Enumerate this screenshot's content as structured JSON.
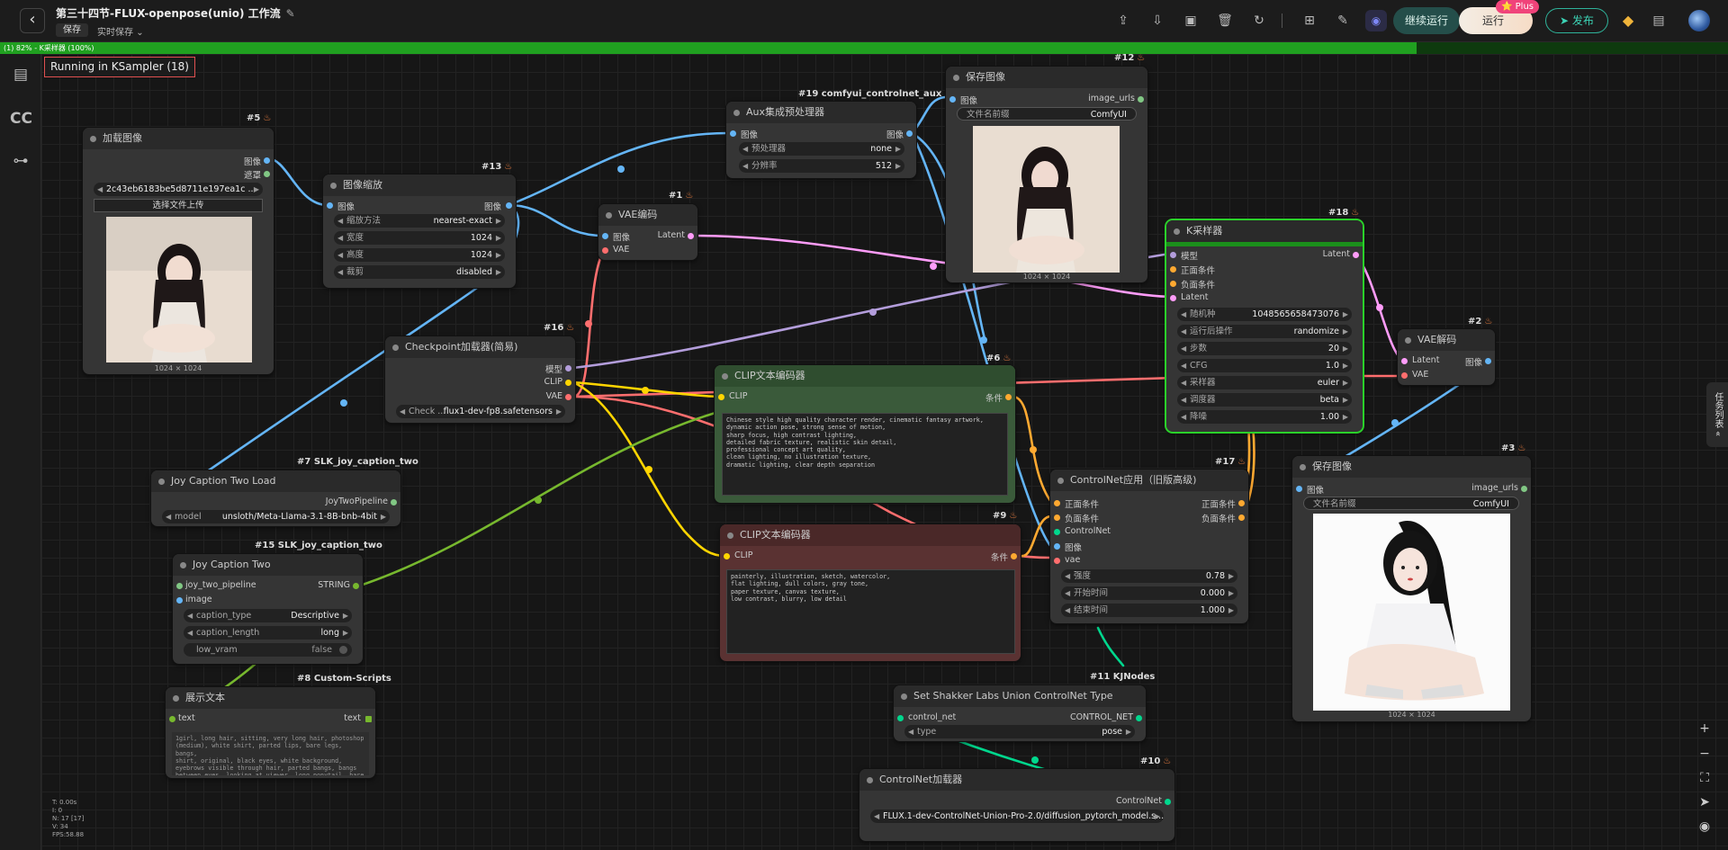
{
  "topbar": {
    "back_icon": "chevron-left-icon",
    "title": "第三十四节-FLUX-openpose(unio) 工作流",
    "edit_icon": "✎",
    "save_label": "保存",
    "autosave_label": "实时保存",
    "continue_label": "继续运行",
    "run_label": "运行",
    "plus_badge": "⭐ Plus",
    "publish_label": "发布",
    "accent_color": "#2fb39a"
  },
  "progress": {
    "label": "(1) 82% - K采样器 (100%)",
    "percent": 82
  },
  "status": {
    "running": "Running in KSampler (18)"
  },
  "stats": [
    "T: 0.00s",
    "I: 0",
    "N: 17 [17]",
    "V: 34",
    "FPS:58.88"
  ],
  "task_panel": "任务列表 «",
  "nodes": {
    "load_image": {
      "tag": "#5",
      "title": "加载图像",
      "out1": "图像",
      "out2": "遮罩",
      "file": "2c43eb6183be5d8711e197ea1c ...",
      "upload": "选择文件上传",
      "dims": "1024 × 1024"
    },
    "image_scale": {
      "tag": "#13",
      "title": "图像缩放",
      "in": "图像",
      "out": "图像",
      "widgets": [
        {
          "n": "缩放方法",
          "v": "nearest-exact"
        },
        {
          "n": "宽度",
          "v": "1024"
        },
        {
          "n": "高度",
          "v": "1024"
        },
        {
          "n": "裁剪",
          "v": "disabled"
        }
      ]
    },
    "vae_encode": {
      "tag": "#1",
      "title": "VAE编码",
      "in1": "图像",
      "in2": "VAE",
      "out": "Latent"
    },
    "aux": {
      "tag": "#19 comfyui_controlnet_aux",
      "title": "Aux集成预处理器",
      "in": "图像",
      "out": "图像",
      "widgets": [
        {
          "n": "预处理器",
          "v": "none"
        },
        {
          "n": "分辨率",
          "v": "512"
        }
      ]
    },
    "save_image_12": {
      "tag": "#12",
      "title": "保存图像",
      "in": "图像",
      "out": "image_urls",
      "prefix_label": "文件名前缀",
      "prefix_value": "ComfyUI",
      "dims": "1024 × 1024"
    },
    "ksampler": {
      "tag": "#18",
      "title": "K采样器",
      "inputs": [
        "模型",
        "正面条件",
        "负面条件",
        "Latent"
      ],
      "out": "Latent",
      "widgets": [
        {
          "n": "随机种",
          "v": "1048565658473076"
        },
        {
          "n": "运行后操作",
          "v": "randomize"
        },
        {
          "n": "步数",
          "v": "20"
        },
        {
          "n": "CFG",
          "v": "1.0"
        },
        {
          "n": "采样器",
          "v": "euler"
        },
        {
          "n": "调度器",
          "v": "beta"
        },
        {
          "n": "降噪",
          "v": "1.00"
        }
      ]
    },
    "vae_decode": {
      "tag": "#2",
      "title": "VAE解码",
      "in1": "Latent",
      "in2": "VAE",
      "out": "图像"
    },
    "checkpoint": {
      "tag": "#16",
      "title": "Checkpoint加载器(简易)",
      "outs": [
        "模型",
        "CLIP",
        "VAE"
      ],
      "widget_name": "Check ...",
      "widget_value": "flux1-dev-fp8.safetensors"
    },
    "clip_pos": {
      "tag": "#6",
      "title": "CLIP文本编码器",
      "in": "CLIP",
      "out": "条件",
      "text": "Chinese style high quality character render, cinematic fantasy artwork,\ndynamic action pose, strong sense of motion,\nsharp focus, high contrast lighting,\ndetailed fabric texture, realistic skin detail,\nprofessional concept art quality,\nclean lighting, no illustration texture,\ndramatic lighting, clear depth separation"
    },
    "clip_neg": {
      "tag": "#9",
      "title": "CLIP文本编码器",
      "in": "CLIP",
      "out": "条件",
      "text": "painterly, illustration, sketch, watercolor,\nflat lighting, dull colors, gray tone,\npaper texture, canvas texture,\nlow contrast, blurry, low detail"
    },
    "joy_load": {
      "tag": "#7 SLK_joy_caption_two",
      "title": "Joy Caption Two Load",
      "out": "JoyTwoPipeline",
      "widget_name": "model",
      "widget_value": "unsloth/Meta-Llama-3.1-8B-bnb-4bit"
    },
    "joy_two": {
      "tag": "#15 SLK_joy_caption_two",
      "title": "Joy Caption Two",
      "in1": "joy_two_pipeline",
      "in2": "image",
      "out": "STRING",
      "widgets": [
        {
          "n": "caption_type",
          "v": "Descriptive"
        },
        {
          "n": "caption_length",
          "v": "long"
        },
        {
          "n": "low_vram",
          "v": "false"
        }
      ]
    },
    "show_text": {
      "tag": "#8 Custom-Scripts",
      "title": "展示文本",
      "in": "text",
      "out": "text",
      "text": "1girl, long hair, sitting, very long hair, photoshop\n(medium), white shirt, parted lips, bare legs, bangs,\nshirt, original, black eyes, white background,\neyebrows visible through hair, parted bangs, bangs\nbetween eyes, looking at viewer, long ponytail, bare"
    },
    "controlnet_apply": {
      "tag": "#17",
      "title": "ControlNet应用（旧版高级)",
      "inputs": [
        "正面条件",
        "负面条件",
        "ControlNet",
        "图像",
        "vae"
      ],
      "out1": "正面条件",
      "out2": "负面条件",
      "widgets": [
        {
          "n": "强度",
          "v": "0.78"
        },
        {
          "n": "开始时间",
          "v": "0.000"
        },
        {
          "n": "结束时间",
          "v": "1.000"
        }
      ]
    },
    "save_image_3": {
      "tag": "#3",
      "title": "保存图像",
      "in": "图像",
      "out": "image_urls",
      "prefix_label": "文件名前缀",
      "prefix_value": "ComfyUI",
      "dims": "1024 × 1024"
    },
    "set_shakker": {
      "tag": "#11 KJNodes",
      "title": "Set Shakker Labs Union ControlNet Type",
      "in": "control_net",
      "out": "CONTROL_NET",
      "widget_name": "type",
      "widget_value": "pose"
    },
    "controlnet_loader": {
      "tag": "#10",
      "title": "ControlNet加载器",
      "out": "ControlNet",
      "widget_value": "FLUX.1-dev-ControlNet-Union-Pro-2.0/diffusion_pytorch_model.s..."
    }
  },
  "colors": {
    "image": "#64b5f6",
    "mask": "#81c784",
    "latent": "#ff9cf9",
    "vae": "#ff6e6e",
    "clip": "#ffd500",
    "model": "#b39ddb",
    "conditioning": "#ffa931",
    "controlnet": "#00d78d",
    "string": "#77b82e"
  }
}
